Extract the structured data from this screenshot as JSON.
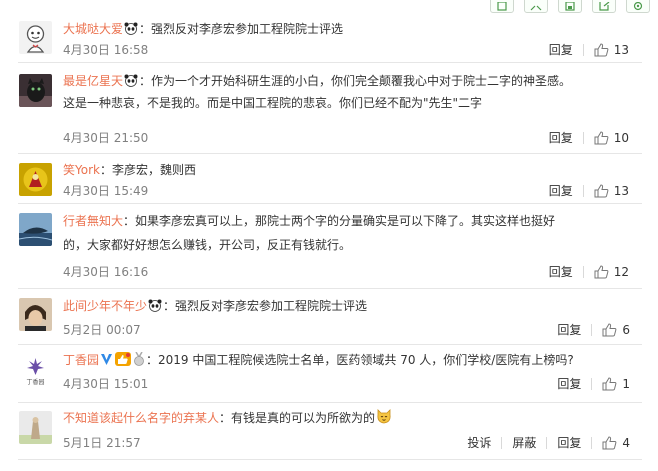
{
  "toolbar": {
    "icons": [
      "bookmark-icon",
      "expand-icon",
      "save-icon",
      "share-icon",
      "settings-icon"
    ]
  },
  "labels": {
    "reply": "回复",
    "report": "投诉",
    "block": "屏蔽"
  },
  "comments": [
    {
      "user": "大城哒大爱",
      "sep": "：",
      "text": "强烈反对李彦宏参加工程院院士评选",
      "date": "4月30日 16:58",
      "likes": "13"
    },
    {
      "user": "最是亿星天",
      "sep": "：",
      "text": "作为一个才开始科研生涯的小白，你们完全颠覆我心中对于院士二字的神圣感。",
      "text2": "这是一种悲哀，不是我的。而是中国工程院的悲哀。你们已经不配为\"先生\"二字",
      "date": "4月30日 21:50",
      "likes": "10"
    },
    {
      "user": "笑York",
      "sep": "：",
      "text": "李彦宏，魏则西",
      "date": "4月30日 15:49",
      "likes": "13"
    },
    {
      "user": "行者無知大",
      "sep": "：",
      "text": "如果李彦宏真可以上，那院士两个字的分量确实是可以下降了。其实这样也挺好",
      "text2": "的，大家都好好想怎么赚钱，开公司，反正有钱就行。",
      "date": "4月30日 16:16",
      "likes": "12"
    },
    {
      "user": "此间少年不年少",
      "sep": "：",
      "text": "强烈反对李彦宏参加工程院院士评选",
      "date": "5月2日 00:07",
      "likes": "6"
    },
    {
      "user": "丁香园",
      "sep": "：",
      "text": "2019 中国工程院候选院士名单，医药领域共 70 人，你们学校/医院有上榜吗?",
      "avatar_text": "丁香园",
      "date": "4月30日 15:01",
      "likes": "1"
    },
    {
      "user": "不知道该起什么名字的弃某人",
      "sep": "：",
      "text": "有钱是真的可以为所欲为的",
      "date": "5月1日 21:57",
      "likes": "4"
    }
  ]
}
